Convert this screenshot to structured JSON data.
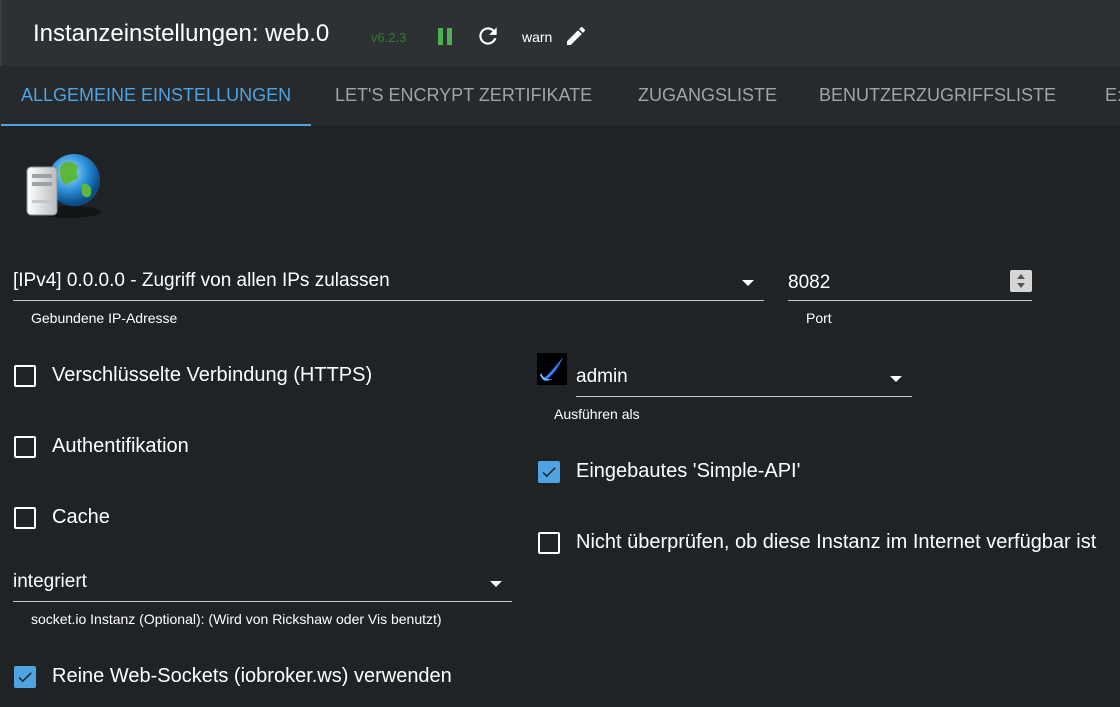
{
  "header": {
    "title": "Instanzeinstellungen: web.0",
    "version": "v6.2.3",
    "loglevel": "warn"
  },
  "tabs": [
    {
      "label": "ALLGEMEINE EINSTELLUNGEN",
      "active": true
    },
    {
      "label": "LET'S ENCRYPT ZERTIFIKATE"
    },
    {
      "label": "ZUGANGSLISTE"
    },
    {
      "label": "BENUTZERZUGRIFFSLISTE"
    },
    {
      "label": "E:"
    }
  ],
  "bind_ip": {
    "value": "[IPv4] 0.0.0.0 - Zugriff von allen IPs zulassen",
    "helper": "Gebundene IP-Adresse"
  },
  "port": {
    "value": "8082",
    "helper": "Port"
  },
  "checkboxes": {
    "https": {
      "label": "Verschlüsselte Verbindung (HTTPS)",
      "checked": false
    },
    "auth": {
      "label": "Authentifikation",
      "checked": false
    },
    "cache": {
      "label": "Cache",
      "checked": false
    },
    "simple_api": {
      "label": "Eingebautes 'Simple-API'",
      "checked": true
    },
    "no_check": {
      "label": "Nicht überprüfen, ob diese Instanz im Internet verfügbar ist",
      "checked": false
    },
    "pure_ws": {
      "label": "Reine Web-Sockets (iobroker.ws) verwenden",
      "checked": true
    }
  },
  "run_as": {
    "value": "admin",
    "helper": "Ausführen als"
  },
  "socketio": {
    "value": "integriert",
    "helper": "socket.io Instanz (Optional): (Wird von Rickshaw oder Vis benutzt)"
  },
  "colors": {
    "accent": "#4fa3e0",
    "background": "#1f2326",
    "version_green": "#2e7d32"
  },
  "icons": [
    "pause-icon",
    "reload-icon",
    "edit-pencil-icon",
    "web-server-globe-icon",
    "user-avatar-icon",
    "dropdown-caret-icon",
    "check-icon"
  ]
}
